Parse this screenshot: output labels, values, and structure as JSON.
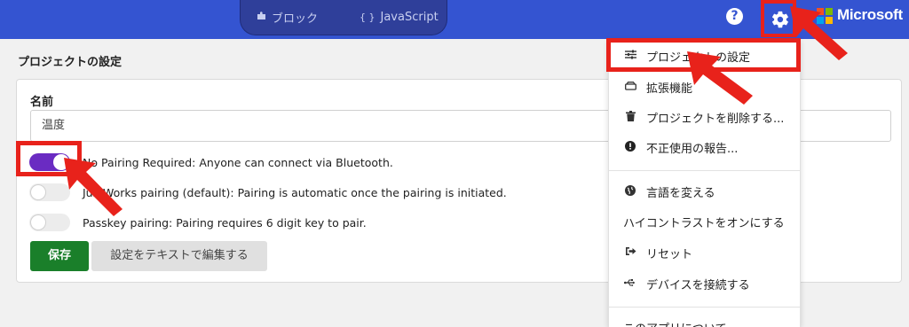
{
  "header": {
    "mode_blocks_label": "ブロック",
    "mode_js_label": "JavaScript",
    "mode_js_icon": "{ }",
    "help_icon": "?",
    "brand": "Microsoft"
  },
  "page": {
    "title": "プロジェクトの設定",
    "name_label": "名前",
    "name_value": "温度",
    "pairing_options": [
      {
        "label": "No Pairing Required: Anyone can connect via Bluetooth.",
        "enabled": true
      },
      {
        "label": "JustWorks pairing (default): Pairing is automatic once the pairing is initiated.",
        "enabled": false
      },
      {
        "label": "Passkey pairing: Pairing requires 6 digit key to pair.",
        "enabled": false
      }
    ],
    "save_label": "保存",
    "edit_as_text_label": "設定をテキストで編集する"
  },
  "menu": {
    "items": [
      {
        "icon": "sliders-icon",
        "label": "プロジェクトの設定"
      },
      {
        "icon": "drive-icon",
        "label": "拡張機能"
      },
      {
        "icon": "trash-icon",
        "label": "プロジェクトを削除する..."
      },
      {
        "icon": "alert-icon",
        "label": "不正使用の報告..."
      },
      {
        "icon": "globe-icon",
        "label": "言語を変える"
      },
      {
        "icon": "",
        "label": "ハイコントラストをオンにする"
      },
      {
        "icon": "signout-icon",
        "label": "リセット"
      },
      {
        "icon": "usb-icon",
        "label": "デバイスを接続する"
      },
      {
        "icon": "",
        "label": "このアプリについて"
      }
    ]
  },
  "colors": {
    "header_bg": "#3454d1",
    "toggle_on": "#6a2bc2",
    "save_button": "#1a7f2a",
    "highlight_red": "#e8221b"
  }
}
